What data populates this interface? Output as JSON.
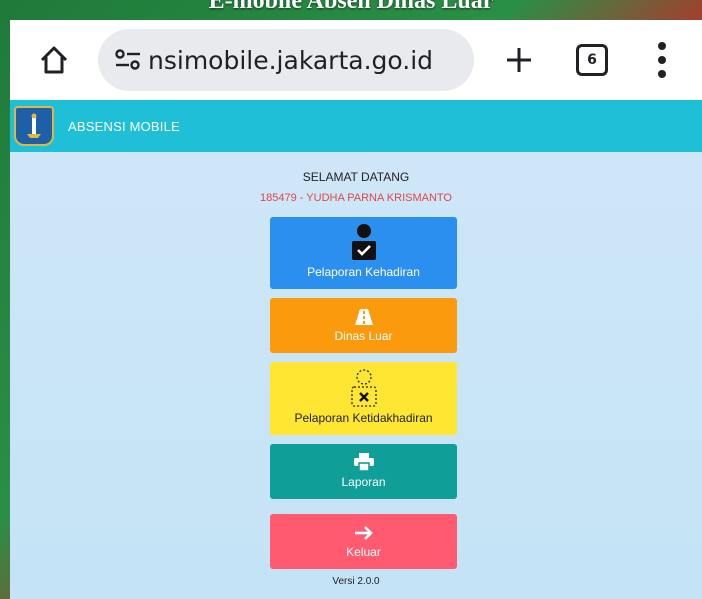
{
  "caption": "E-mobile Absen Dinas Luar",
  "browser": {
    "url": "nsimobile.jakarta.go.id",
    "tab_count": "6"
  },
  "app": {
    "title": "ABSENSI MOBILE",
    "welcome": "SELAMAT DATANG",
    "user": "185479 - YUDHA PARNA KRISMANTO",
    "menu": {
      "kehadiran": "Pelaporan Kehadiran",
      "dinas_luar": "Dinas Luar",
      "ketidakhadiran": "Pelaporan Ketidakhadiran",
      "laporan": "Laporan",
      "keluar": "Keluar"
    },
    "version": "Versi 2.0.0",
    "colors": {
      "header": "#1fbfd7",
      "kehadiran": "#2b8ff0",
      "dinas_luar": "#fb9a0d",
      "ketidakhadiran": "#ffe632",
      "laporan": "#0f9f98",
      "keluar": "#ff5a70"
    }
  }
}
